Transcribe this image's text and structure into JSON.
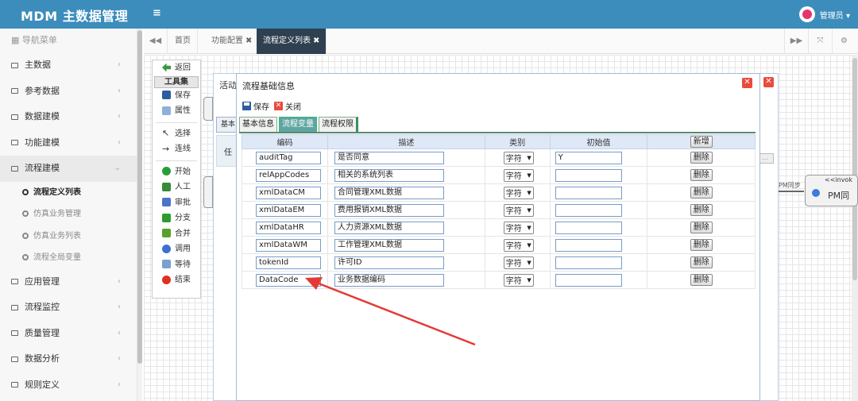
{
  "app": {
    "title": "MDM 主数据管理",
    "menu_toggle": "≡",
    "user_name": "管理员 ▾"
  },
  "sidebar": {
    "header": "导航菜单",
    "items_top": [
      {
        "label": "主数据"
      },
      {
        "label": "参考数据"
      },
      {
        "label": "数据建模"
      },
      {
        "label": "功能建模"
      }
    ],
    "open_item": {
      "label": "流程建模"
    },
    "sub_items": [
      {
        "label": "流程定义列表",
        "active": true
      },
      {
        "label": "仿真业务管理"
      },
      {
        "label": "仿真业务列表"
      },
      {
        "label": "流程全局变量"
      }
    ],
    "items_bottom": [
      {
        "label": "应用管理"
      },
      {
        "label": "流程监控"
      },
      {
        "label": "质量管理"
      },
      {
        "label": "数据分析"
      },
      {
        "label": "规则定义"
      }
    ]
  },
  "tabs": [
    {
      "label": "首页"
    },
    {
      "label": "功能配置",
      "close": "✖"
    },
    {
      "label": "流程定义列表",
      "close": "✖",
      "active": true
    }
  ],
  "toolbox": {
    "back": "返回",
    "header": "工具集",
    "save": "保存",
    "attrs": "属性",
    "select": "选择",
    "connect": "连线",
    "start": "开始",
    "manual": "人工",
    "approve": "审批",
    "branch": "分支",
    "merge": "合并",
    "invoke": "调用",
    "wait": "等待",
    "end": "结束"
  },
  "background_dialog": {
    "title": "活动",
    "tab": "基本",
    "side": "任"
  },
  "canvas": {
    "node_stereotype": "<<invok",
    "node_name": "PM同",
    "edge_label": "PM同步"
  },
  "dialog": {
    "title": "流程基础信息",
    "save_label": "保存",
    "close_label": "关闭",
    "tabs": [
      {
        "label": "基本信息"
      },
      {
        "label": "流程变量",
        "active": true
      },
      {
        "label": "流程权限"
      }
    ],
    "columns": {
      "code": "编码",
      "desc": "描述",
      "type": "类别",
      "init": "初始值",
      "add": "新增"
    },
    "rows": [
      {
        "code": "auditTag",
        "desc": "是否同意",
        "type": "字符",
        "init": "Y",
        "action": "删除"
      },
      {
        "code": "relAppCodes",
        "desc": "相关的系统列表",
        "type": "字符",
        "init": "",
        "action": "删除"
      },
      {
        "code": "xmlDataCM",
        "desc": "合同管理XML数据",
        "type": "字符",
        "init": "",
        "action": "删除"
      },
      {
        "code": "xmlDataEM",
        "desc": "费用报销XML数据",
        "type": "字符",
        "init": "",
        "action": "删除"
      },
      {
        "code": "xmlDataHR",
        "desc": "人力资源XML数据",
        "type": "字符",
        "init": "",
        "action": "删除"
      },
      {
        "code": "xmlDataWM",
        "desc": "工作管理XML数据",
        "type": "字符",
        "init": "",
        "action": "删除"
      },
      {
        "code": "tokenId",
        "desc": "许可ID",
        "type": "字符",
        "init": "",
        "action": "删除"
      },
      {
        "code": "DataCode",
        "desc": "业务数据编码",
        "type": "字符",
        "init": "",
        "action": "删除"
      }
    ]
  },
  "colors": {
    "header_bg": "#3c8dbc",
    "active_tab_bg": "#2f4050",
    "dialog_tab_active": "#5fa5a1",
    "annotation": "#e53935"
  }
}
